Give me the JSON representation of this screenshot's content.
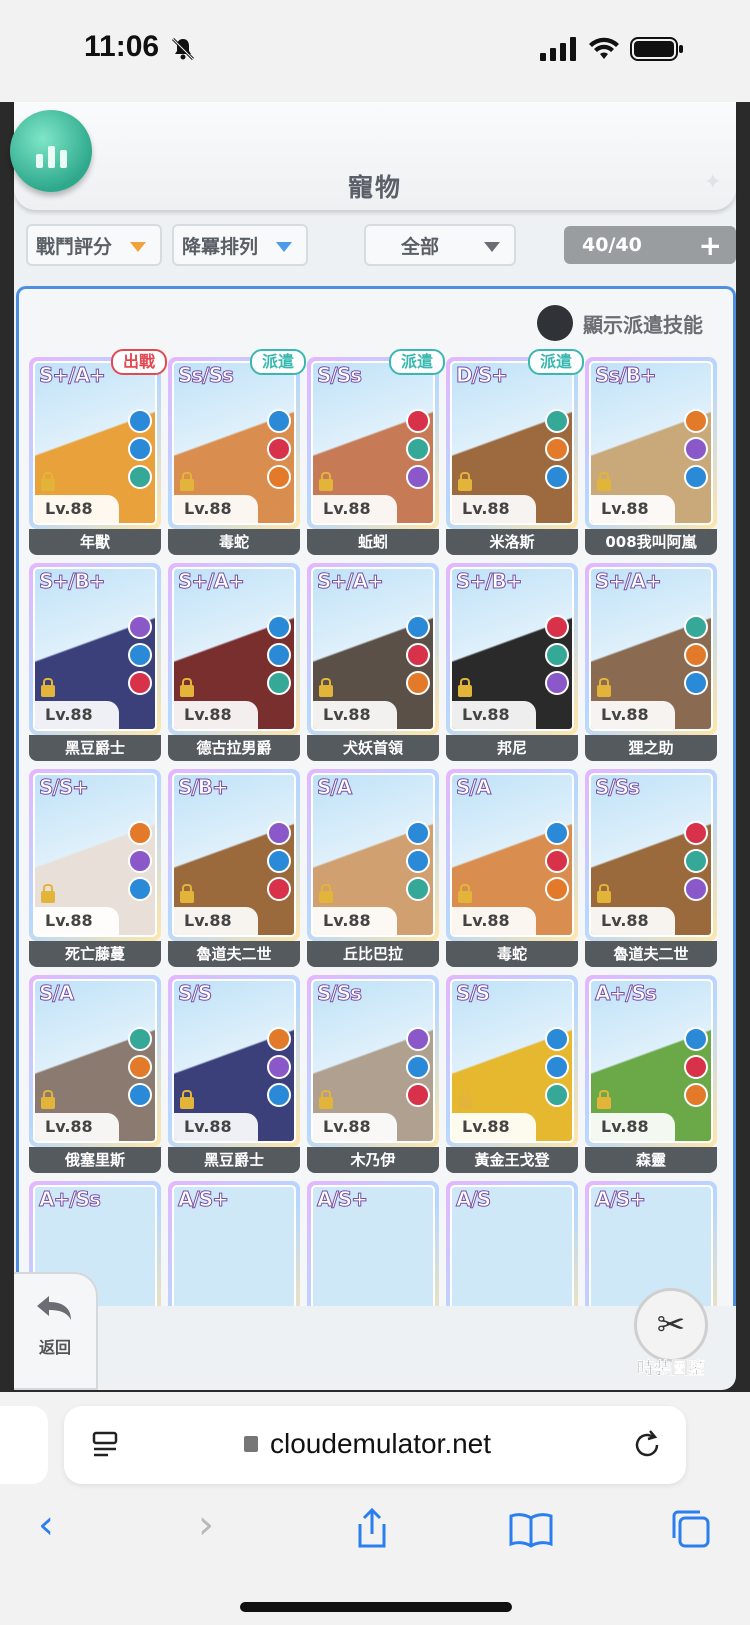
{
  "status": {
    "time": "11:06"
  },
  "header": {
    "title": "寵物"
  },
  "filters": {
    "sort_score": "戰鬥評分",
    "sort_order": "降冪排列",
    "category": "全部",
    "count": "40/40"
  },
  "toggle_label": "顯示派遣技能",
  "pets": [
    {
      "rank": "S+/A+",
      "name": "年獸",
      "level": "Lv.88",
      "tag": "出戰"
    },
    {
      "rank": "Ss/Ss",
      "name": "毒蛇",
      "level": "Lv.88",
      "tag": "派遣"
    },
    {
      "rank": "S/Ss",
      "name": "蚯蚓",
      "level": "Lv.88",
      "tag": "派遣"
    },
    {
      "rank": "D/S+",
      "name": "米洛斯",
      "level": "Lv.88",
      "tag": "派遣"
    },
    {
      "rank": "Ss/B+",
      "name": "008我叫阿嵐",
      "level": "Lv.88",
      "tag": ""
    },
    {
      "rank": "S+/B+",
      "name": "黑豆爵士",
      "level": "Lv.88",
      "tag": ""
    },
    {
      "rank": "S+/A+",
      "name": "德古拉男爵",
      "level": "Lv.88",
      "tag": ""
    },
    {
      "rank": "S+/A+",
      "name": "犬妖首領",
      "level": "Lv.88",
      "tag": ""
    },
    {
      "rank": "S+/B+",
      "name": "邦尼",
      "level": "Lv.88",
      "tag": ""
    },
    {
      "rank": "S+/A+",
      "name": "狸之助",
      "level": "Lv.88",
      "tag": ""
    },
    {
      "rank": "S/S+",
      "name": "死亡藤蔓",
      "level": "Lv.88",
      "tag": ""
    },
    {
      "rank": "S/B+",
      "name": "魯道夫二世",
      "level": "Lv.88",
      "tag": ""
    },
    {
      "rank": "S/A",
      "name": "丘比巴拉",
      "level": "Lv.88",
      "tag": ""
    },
    {
      "rank": "S/A",
      "name": "毒蛇",
      "level": "Lv.88",
      "tag": ""
    },
    {
      "rank": "S/Ss",
      "name": "魯道夫二世",
      "level": "Lv.88",
      "tag": ""
    },
    {
      "rank": "S/A",
      "name": "俄塞里斯",
      "level": "Lv.88",
      "tag": ""
    },
    {
      "rank": "S/S",
      "name": "黑豆爵士",
      "level": "Lv.88",
      "tag": ""
    },
    {
      "rank": "S/Ss",
      "name": "木乃伊",
      "level": "Lv.88",
      "tag": ""
    },
    {
      "rank": "S/S",
      "name": "黃金王戈登",
      "level": "Lv.88",
      "tag": ""
    },
    {
      "rank": "A+/Ss",
      "name": "森靈",
      "level": "Lv.88",
      "tag": ""
    }
  ],
  "partial_ranks": [
    "A+/Ss",
    "A/S+",
    "A/S+",
    "A/S",
    "A/S+"
  ],
  "bottom": {
    "back_label": "返回",
    "costume_label": "時裝圖鑒"
  },
  "browser": {
    "url": "cloudemulator.net"
  },
  "colors": {
    "accent_blue": "#4f8fe0",
    "battle_red": "#e24a52",
    "dispatch_teal": "#38b8b0",
    "orb_green": "#2fa98c"
  }
}
